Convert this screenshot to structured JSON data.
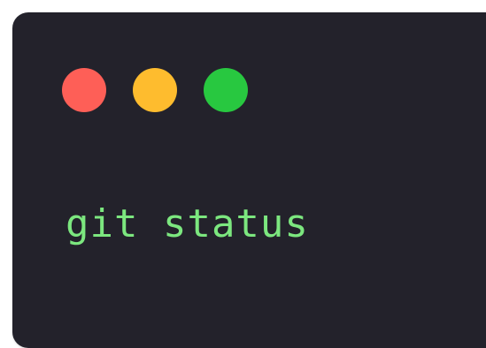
{
  "window": {
    "background_color": "#23222b",
    "controls": [
      {
        "name": "close-dot",
        "color": "#fe5f57"
      },
      {
        "name": "minimize-dot",
        "color": "#febc2e"
      },
      {
        "name": "maximize-dot",
        "color": "#28c840"
      }
    ]
  },
  "terminal": {
    "command": "git status",
    "text_color": "#7ce77f"
  }
}
